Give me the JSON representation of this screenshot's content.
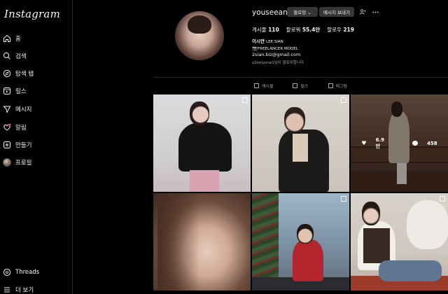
{
  "app": {
    "logo": "Instagram"
  },
  "sidebar": {
    "items": [
      {
        "label": "홈",
        "icon": "home-icon"
      },
      {
        "label": "검색",
        "icon": "search-icon"
      },
      {
        "label": "탐색 탭",
        "icon": "compass-icon"
      },
      {
        "label": "릴스",
        "icon": "reels-icon"
      },
      {
        "label": "메시지",
        "icon": "send-icon"
      },
      {
        "label": "알림",
        "icon": "heart-icon"
      },
      {
        "label": "만들기",
        "icon": "plus-icon"
      },
      {
        "label": "프로필",
        "icon": "avatar"
      }
    ],
    "bottom": [
      {
        "label": "Threads",
        "icon": "threads-icon"
      },
      {
        "label": "더 보기",
        "icon": "menu-icon"
      }
    ]
  },
  "profile": {
    "username": "youseeany",
    "follow_label": "팔로잉 ⌄",
    "message_label": "메시지 보내기",
    "posts_label": "게시물",
    "posts_count": "110",
    "followers_label": "팔로워",
    "followers_count": "55.4만",
    "following_label": "팔로우",
    "following_count": "219",
    "full_name": "이시안",
    "name_en": "LEE SIAN",
    "bio_line1": "FREELANCER MODEL",
    "bio_line2": "2sian.biz@gmail.com",
    "followed_by": "s2onlyone1님이 팔로우합니다"
  },
  "tabs": [
    {
      "label": "게시물"
    },
    {
      "label": "릴스"
    },
    {
      "label": "태그됨"
    }
  ],
  "hover_post": {
    "likes": "6.9만",
    "comments": "458"
  },
  "colors": {
    "background": "#000000",
    "button": "#363636",
    "divider": "#262626"
  }
}
